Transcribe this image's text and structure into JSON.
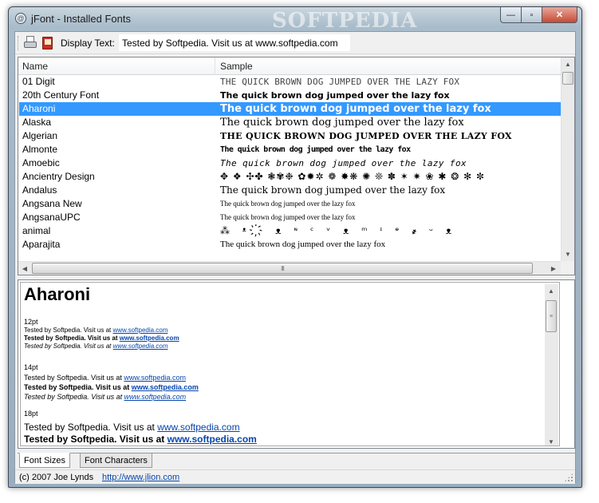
{
  "window": {
    "title": "jFont - Installed Fonts",
    "watermark": "SOFTPEDIA",
    "controls": {
      "minimize": "—",
      "maximize": "▫",
      "close": "✕"
    },
    "app_icon": "at-sign-icon"
  },
  "toolbar": {
    "print_icon": "printer-icon",
    "book_icon": "book-icon",
    "display_label": "Display Text:",
    "display_value": "Tested by Softpedia. Visit us at www.softpedia.com"
  },
  "fontlist": {
    "columns": [
      "Name",
      "Sample"
    ],
    "selected_index": 2,
    "rows": [
      {
        "name": "01 Digit",
        "sample": "THE QUICK BROWN DOG JUMPED OVER THE LAZY FOX"
      },
      {
        "name": "20th Century Font",
        "sample": "The quick brown dog jumped over the lazy fox"
      },
      {
        "name": "Aharoni",
        "sample": "The quick brown dog jumped over the lazy fox"
      },
      {
        "name": "Alaska",
        "sample": "The quick brown dog jumped over the lazy fox"
      },
      {
        "name": "Algerian",
        "sample": "THE QUICK BROWN DOG JUMPED OVER THE LAZY FOX"
      },
      {
        "name": "Almonte",
        "sample": "The quick brown dog jumped over the lazy fox"
      },
      {
        "name": "Amoebic",
        "sample": "The quick brown dog jumped over the lazy fox"
      },
      {
        "name": "Ancientry  Design",
        "sample": "✥ ❖ ✣✤ ❃✾❉ ✿✹✲ ❁ ✸❋ ✺ ❊ ✽ ✶ ✷ ❀ ✱ ❂ ✻ ✼"
      },
      {
        "name": "Andalus",
        "sample": "The quick brown dog jumped over the lazy fox"
      },
      {
        "name": "Angsana New",
        "sample": "The quick brown dog jumped over the lazy fox"
      },
      {
        "name": "AngsanaUPC",
        "sample": "The quick brown dog jumped over the lazy fox"
      },
      {
        "name": "animal",
        "sample": "⁂ ᵜ ҉ ᴥ ᶰ ᶜ ᵛ ᴥ ᵐ ᶦ ᶱ ҂ ᵕ ᴥ"
      },
      {
        "name": "Aparajita",
        "sample": "The quick brown dog jumped over the lazy fox"
      }
    ],
    "hscroll_thumb_glyph": "III"
  },
  "preview": {
    "font_name": "Aharoni",
    "sizes": [
      {
        "label": "12pt",
        "text": "Tested by Softpedia. Visit us at ",
        "link": "www.softpedia.com"
      },
      {
        "label": "14pt",
        "text": "Tested by Softpedia. Visit us at ",
        "link": "www.softpedia.com"
      },
      {
        "label": "18pt",
        "text": "Tested by Softpedia. Visit us at ",
        "link": "www.softpedia.com"
      }
    ]
  },
  "tabs": {
    "font_sizes": "Font Sizes",
    "font_characters": "Font Characters"
  },
  "status": {
    "copyright": "(c) 2007 Joe Lynds",
    "url": "http://www.jlion.com"
  }
}
